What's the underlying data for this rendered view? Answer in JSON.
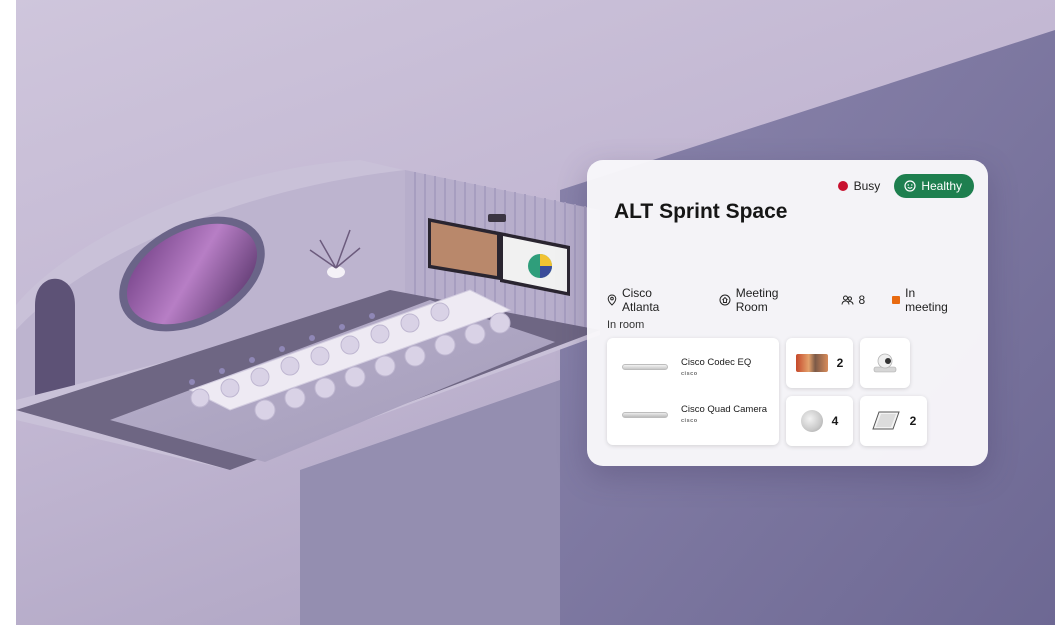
{
  "room_card": {
    "title": "ALT Sprint Space",
    "status": {
      "busy_label": "Busy",
      "health_label": "Healthy",
      "busy_color": "#c8102e",
      "health_color": "#1e7f4f"
    },
    "meta": {
      "location": "Cisco Atlanta",
      "type": "Meeting Room",
      "capacity": "8",
      "activity": "In meeting"
    },
    "in_room_label": "In room",
    "devices": [
      {
        "name": "Cisco Codec EQ",
        "brand": "cisco"
      },
      {
        "name": "Cisco Quad Camera",
        "brand": "cisco"
      }
    ],
    "peripherals": [
      {
        "kind": "room-display",
        "count": "2"
      },
      {
        "kind": "ptz-camera",
        "count": ""
      },
      {
        "kind": "table-microphone",
        "count": "4"
      },
      {
        "kind": "touch-controller",
        "count": "2"
      }
    ]
  },
  "icons": [
    "location-pin-icon",
    "room-icon",
    "people-icon",
    "camera-icon",
    "smile-icon"
  ]
}
